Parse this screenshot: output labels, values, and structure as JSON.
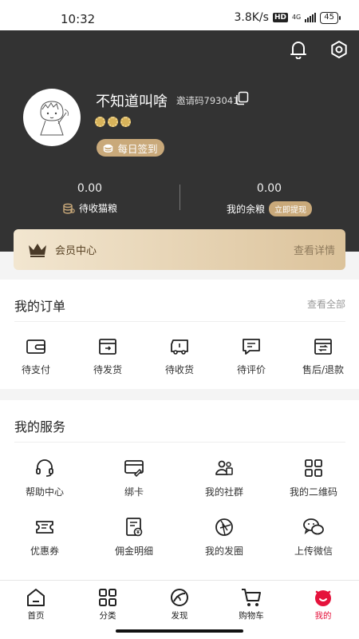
{
  "status_bar": {
    "time": "10:32",
    "speed": "3.8K/s",
    "hd": "HD",
    "network": "4G",
    "battery": "45"
  },
  "profile": {
    "username": "不知道叫啥",
    "invite_code": "邀请码793041",
    "checkin_label": "每日签到"
  },
  "balances": {
    "pending": {
      "value": "0.00",
      "label": "待收猫粮"
    },
    "balance": {
      "value": "0.00",
      "label": "我的余粮",
      "action": "立即提现"
    }
  },
  "vip": {
    "title": "会员中心",
    "more": "查看详情"
  },
  "orders": {
    "title": "我的订单",
    "more": "查看全部",
    "items": [
      {
        "label": "待支付",
        "icon": "wallet-icon"
      },
      {
        "label": "待发货",
        "icon": "box-send-icon"
      },
      {
        "label": "待收货",
        "icon": "truck-icon"
      },
      {
        "label": "待评价",
        "icon": "comment-icon"
      },
      {
        "label": "售后/退款",
        "icon": "refund-icon"
      }
    ]
  },
  "services": {
    "title": "我的服务",
    "items": [
      {
        "label": "帮助中心",
        "icon": "headset-icon"
      },
      {
        "label": "绑卡",
        "icon": "card-icon"
      },
      {
        "label": "我的社群",
        "icon": "community-icon"
      },
      {
        "label": "我的二维码",
        "icon": "qrcode-icon"
      },
      {
        "label": "优惠券",
        "icon": "coupon-icon"
      },
      {
        "label": "佣金明细",
        "icon": "commission-icon"
      },
      {
        "label": "我的发圈",
        "icon": "aperture-icon"
      },
      {
        "label": "上传微信",
        "icon": "wechat-icon"
      }
    ]
  },
  "tabs": [
    {
      "label": "首页",
      "icon": "home-icon"
    },
    {
      "label": "分类",
      "icon": "category-icon"
    },
    {
      "label": "发现",
      "icon": "discover-icon"
    },
    {
      "label": "购物车",
      "icon": "cart-icon"
    },
    {
      "label": "我的",
      "icon": "mine-icon",
      "active": true
    }
  ],
  "colors": {
    "header_bg": "#333333",
    "gold": "#c9a97a",
    "accent_red": "#e5133c"
  }
}
